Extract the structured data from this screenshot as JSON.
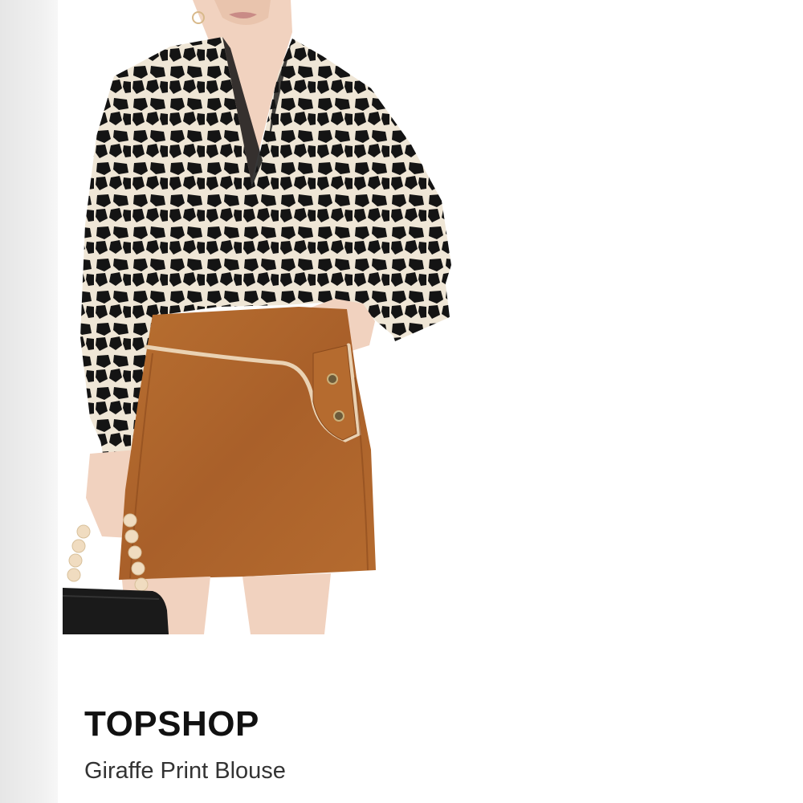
{
  "product": {
    "brand": "TOPSHOP",
    "name": "Giraffe Print Blouse"
  },
  "colors": {
    "background": "#ffffff",
    "gutter": "#ebebeb",
    "blouse_base": "#efe6d6",
    "blouse_print": "#141414",
    "skirt": "#b06a2d",
    "skin": "#f1d2bf",
    "bag": "#1a1a1a",
    "beads": "#f0dcc0"
  },
  "image": {
    "subject": "model-photo"
  }
}
